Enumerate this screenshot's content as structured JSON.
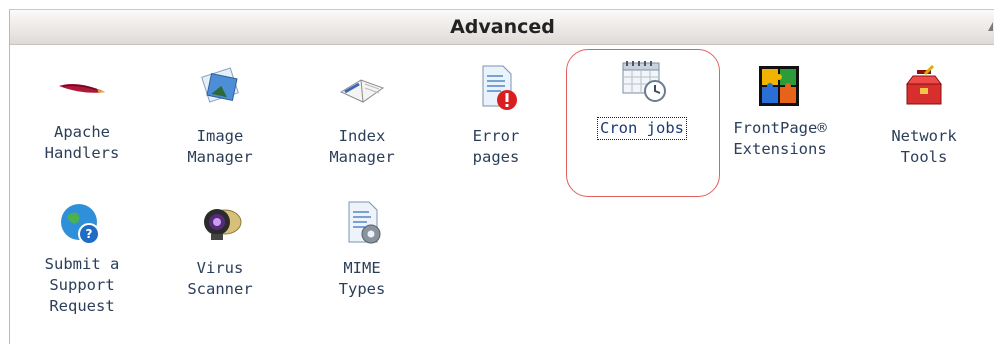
{
  "section": {
    "title": "Advanced"
  },
  "items": [
    {
      "label": "Apache Handlers",
      "icon": "apache-feather-icon"
    },
    {
      "label": "Image Manager",
      "icon": "image-manager-icon"
    },
    {
      "label": "Index Manager",
      "icon": "index-book-icon"
    },
    {
      "label": "Error pages",
      "icon": "error-page-icon"
    },
    {
      "label": "Cron jobs",
      "icon": "cron-calendar-clock-icon"
    },
    {
      "label": "FrontPage® Extensions",
      "icon": "frontpage-puzzle-icon"
    },
    {
      "label": "Network Tools",
      "icon": "toolbox-icon"
    },
    {
      "label": "Submit a Support Request",
      "icon": "support-globe-icon"
    },
    {
      "label": "Virus Scanner",
      "icon": "webcam-scanner-icon"
    },
    {
      "label": "MIME Types",
      "icon": "mime-document-gear-icon"
    }
  ],
  "colors": {
    "label_text": "#2c3f5a",
    "highlight": "#e06060",
    "header_bg": "#ece9e6"
  }
}
